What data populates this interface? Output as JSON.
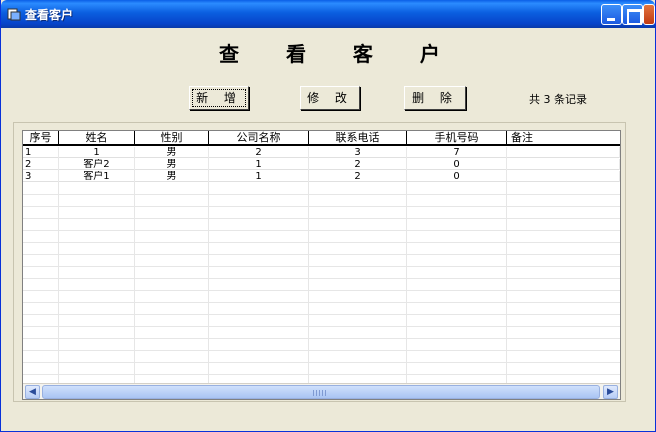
{
  "window": {
    "title": "查看客户"
  },
  "page": {
    "heading": "查 看 客 户"
  },
  "toolbar": {
    "add_label": "新 增",
    "edit_label": "修 改",
    "delete_label": "删 除",
    "record_count": "共 3 条记录"
  },
  "grid": {
    "columns": [
      "序号",
      "姓名",
      "性别",
      "公司名称",
      "联系电话",
      "手机号码",
      "备注"
    ],
    "rows": [
      [
        "1",
        "1",
        "男",
        "2",
        "3",
        "7",
        ""
      ],
      [
        "2",
        "客户2",
        "男",
        "1",
        "2",
        "0",
        ""
      ],
      [
        "3",
        "客户1",
        "男",
        "1",
        "2",
        "0",
        ""
      ]
    ]
  },
  "icons": {
    "app": "window-app-icon",
    "minimize": "minimize-icon",
    "maximize": "maximize-icon",
    "scroll_left": "chevron-left-icon",
    "scroll_right": "chevron-right-icon"
  },
  "colors": {
    "titlebar": "#0b5fe0",
    "window_bg": "#ece9d8"
  }
}
